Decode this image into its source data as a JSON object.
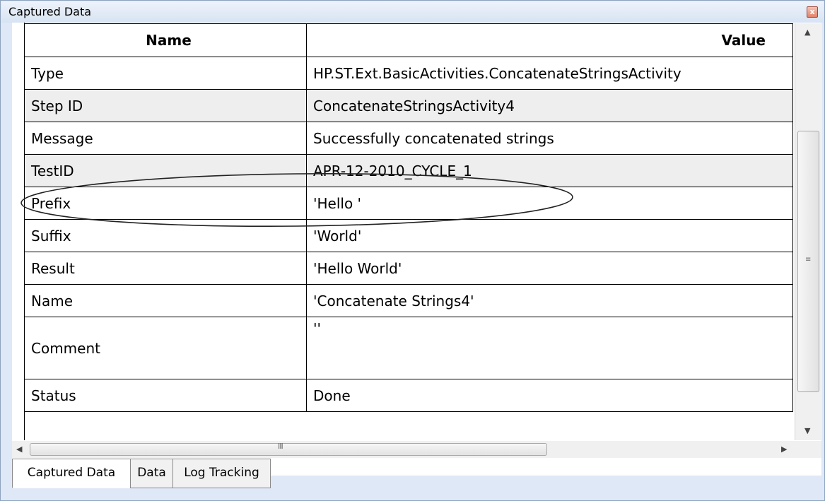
{
  "window": {
    "title": "Captured Data",
    "close_glyph": "x"
  },
  "grid": {
    "headers": {
      "name": "Name",
      "value": "Value"
    },
    "rows": [
      {
        "name": "Type",
        "value": "HP.ST.Ext.BasicActivities.ConcatenateStringsActivity"
      },
      {
        "name": "Step ID",
        "value": "ConcatenateStringsActivity4"
      },
      {
        "name": "Message",
        "value": "Successfully concatenated strings"
      },
      {
        "name": "TestID",
        "value": "APR-12-2010_CYCLE_1"
      },
      {
        "name": "Prefix",
        "value": "'Hello '"
      },
      {
        "name": "Suffix",
        "value": "'World'"
      },
      {
        "name": "Result",
        "value": "'Hello World'"
      },
      {
        "name": "Name",
        "value": "'Concatenate Strings4'"
      },
      {
        "name": "Comment",
        "value": "''"
      },
      {
        "name": "Status",
        "value": "Done"
      }
    ]
  },
  "scrollbars": {
    "up_arrow": "▲",
    "down_arrow": "▼",
    "left_arrow": "◀",
    "right_arrow": "▶",
    "v_grip": "≡",
    "h_grip": "III"
  },
  "tabs": [
    {
      "label": "Captured Data",
      "active": true
    },
    {
      "label": "Data",
      "active": false
    },
    {
      "label": "Log Tracking",
      "active": false
    }
  ]
}
